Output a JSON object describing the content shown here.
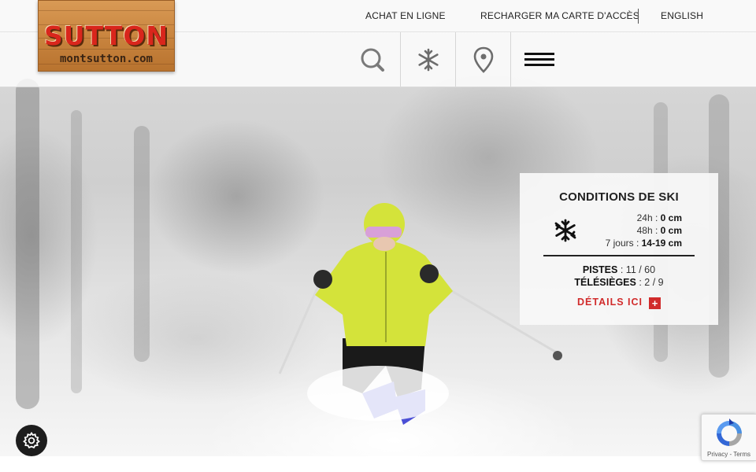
{
  "topbar": {
    "buy_online": "ACHAT EN LIGNE",
    "reload_card": "RECHARGER MA CARTE D'ACCÈS",
    "language": "ENGLISH"
  },
  "logo": {
    "main": "SUTTON",
    "sub": "montsutton.com"
  },
  "nav": {
    "icons": [
      "search-icon",
      "snowflake-icon",
      "map-pin-icon",
      "hamburger-menu-icon"
    ]
  },
  "conditions": {
    "title": "CONDITIONS DE SKI",
    "snow": [
      {
        "label": "24h :",
        "value": "0 cm"
      },
      {
        "label": "48h :",
        "value": "0 cm"
      },
      {
        "label": "7 jours :",
        "value": "14-19 cm"
      }
    ],
    "pistes_label": "PISTES",
    "pistes_value": ": 11 / 60",
    "lifts_label": "TÉLÉSIÈGES",
    "lifts_value": ": 2 / 9",
    "details": "DÉTAILS ICI",
    "details_plus": "+"
  },
  "recaptcha": {
    "privacy": "Privacy",
    "sep": " - ",
    "terms": "Terms"
  },
  "colors": {
    "accent_red": "#d12b2b",
    "logo_red": "#d9261c",
    "wood": "#c9853f",
    "jacket": "#d4e33a",
    "skis": "#4b4fd6"
  }
}
